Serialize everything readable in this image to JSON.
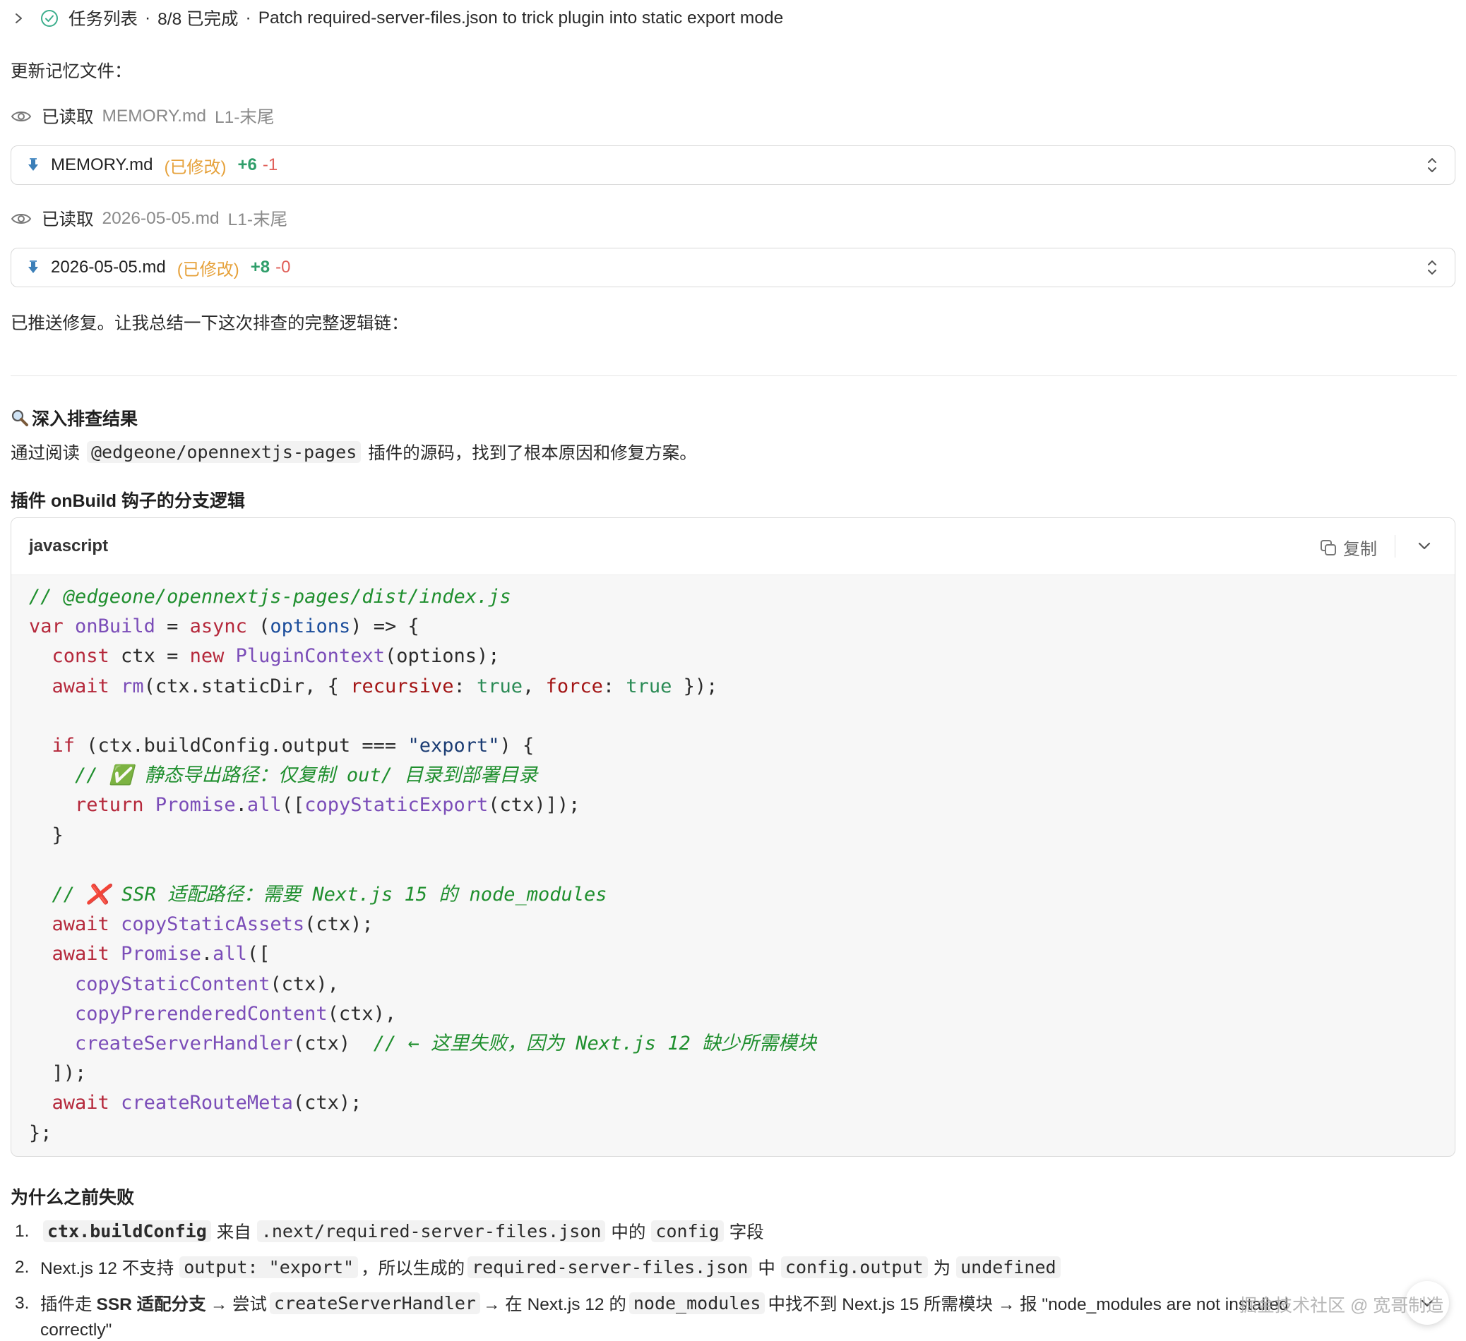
{
  "task": {
    "title": "任务列表",
    "progress": "8/8 已完成",
    "separator": "·",
    "description": "Patch required-server-files.json to trick plugin into static export mode"
  },
  "messages": {
    "update_memory": "更新记忆文件：",
    "pushed_fix": "已推送修复。让我总结一下这次排查的完整逻辑链："
  },
  "reads": [
    {
      "label": "已读取",
      "file": "MEMORY.md",
      "range": "L1-末尾"
    },
    {
      "label": "已读取",
      "file": "2026-05-05.md",
      "range": "L1-末尾"
    }
  ],
  "edits": [
    {
      "file": "MEMORY.md",
      "status": "(已修改)",
      "added": "+6",
      "removed": "-1"
    },
    {
      "file": "2026-05-05.md",
      "status": "(已修改)",
      "added": "+8",
      "removed": "-0"
    }
  ],
  "section": {
    "title": "深入排查结果",
    "icon": "magnifier-icon",
    "intro_before": "通过阅读",
    "intro_code": "@edgeone/opennextjs-pages",
    "intro_after": "插件的源码，找到了根本原因和修复方案。",
    "subtitle": "插件 onBuild 钩子的分支逻辑"
  },
  "code_block": {
    "language": "javascript",
    "copy_label": "复制",
    "lines": {
      "l1": "// @edgeone/opennextjs-pages/dist/index.js",
      "l2_var": "var",
      "l2_name": "onBuild",
      "l2_eq": " = ",
      "l2_async": "async",
      "l2_rest1": " (",
      "l2_opts": "options",
      "l2_rest2": ") => {",
      "l3_const": "const",
      "l3_rest1": " ctx = ",
      "l3_new": "new",
      "l3_cls": "PluginContext",
      "l3_rest2": "(options);",
      "l4_await": "await",
      "l4_fn": "rm",
      "l4_rest1": "(ctx.staticDir, { ",
      "l4_p1": "recursive",
      "l4_c1": ": ",
      "l4_t1": "true",
      "l4_comma": ", ",
      "l4_p2": "force",
      "l4_c2": ": ",
      "l4_t2": "true",
      "l4_rest2": " });",
      "l6_if": "if",
      "l6_rest1": " (ctx.buildConfig.output === ",
      "l6_str": "\"export\"",
      "l6_rest2": ") {",
      "l7": "// ✅ 静态导出路径：仅复制 out/ 目录到部署目录",
      "l8_ret": "return",
      "l8_promise": "Promise",
      "l8_dot": ".",
      "l8_all": "all",
      "l8_rest1": "([",
      "l8_fn": "copyStaticExport",
      "l8_rest2": "(ctx)]);",
      "l9": "}",
      "l11": "// ❌ SSR 适配路径：需要 Next.js 15 的 node_modules",
      "l12_await": "await",
      "l12_fn": "copyStaticAssets",
      "l12_rest": "(ctx);",
      "l13_await": "await",
      "l13_promise": "Promise",
      "l13_dot": ".",
      "l13_all": "all",
      "l13_rest": "([",
      "l14_fn": "copyStaticContent",
      "l14_rest": "(ctx),",
      "l15_fn": "copyPrerenderedContent",
      "l15_rest": "(ctx),",
      "l16_fn": "createServerHandler",
      "l16_rest": "(ctx)  ",
      "l16_cmt": "// ← 这里失败，因为 Next.js 12 缺少所需模块",
      "l17": "]);",
      "l18_await": "await",
      "l18_fn": "createRouteMeta",
      "l18_rest": "(ctx);",
      "l19": "};"
    }
  },
  "why": {
    "title": "为什么之前失败",
    "item1": {
      "num": "1.",
      "code1": "ctx.buildConfig",
      "t1": "来自",
      "code2": ".next/required-server-files.json",
      "t2": "中的",
      "code3": "config",
      "t3": "字段"
    },
    "item2": {
      "num": "2.",
      "t1": "Next.js 12 不支持",
      "code1": "output: \"export\"",
      "t2": "，所以生成的",
      "code2": "required-server-files.json",
      "t3": "中",
      "code3": "config.output",
      "t4": "为",
      "code4": "undefined"
    },
    "item3": {
      "num": "3.",
      "t1": "插件走",
      "b1": "SSR 适配分支",
      "t2": "→ 尝试",
      "code1": "createServerHandler",
      "t3": "→ 在 Next.js 12 的",
      "code2": "node_modules",
      "t4": "中找不到 Next.js 15 所需模块 → 报 \"node_modules are not installed",
      "t5": "correctly\""
    }
  },
  "watermark": "掘金技术社区 @ 宽哥制造",
  "colors": {
    "success_green": "#3cae8c",
    "modified_orange": "#e6a23c",
    "added_green": "#2f9e6a",
    "removed_red": "#e0605a",
    "download_blue": "#3c7fb8"
  }
}
